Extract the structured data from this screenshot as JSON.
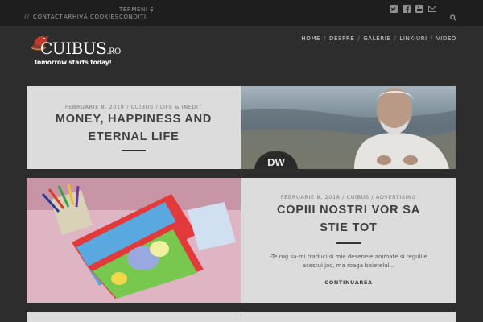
{
  "topbar": {
    "separator": "//",
    "links": [
      "Contact",
      "Arhivă",
      "Cookies",
      "Termeni și",
      "Condiții"
    ],
    "social_icons": [
      "twitter-icon",
      "facebook-icon",
      "youtube-icon",
      "email-icon"
    ],
    "search_icon": "search-icon"
  },
  "header": {
    "logo_text": "CUIBUS",
    "logo_suffix": ".RO",
    "tagline": "Tomorrow starts today!",
    "nav": [
      "Home",
      "Despre",
      "Galerie",
      "Link-uri",
      "Video"
    ]
  },
  "posts": [
    {
      "meta": "Februarie 8, 2018 / Cuibus / Life & Inedit",
      "title_line1": "MONEY, HAPPINESS AND",
      "title_line2": "ETERNAL LIFE"
    },
    {
      "image_badge": "DW"
    },
    {
      "image_alt": "Hippo and Friends puzzle books"
    },
    {
      "meta": "Februarie 8, 2018 / Cuibus / Advertising",
      "title_line1": "COPIII NOSTRI VOR SA",
      "title_line2": "STIE TOT",
      "excerpt": "-Te rog sa-mi traduci si mie desenele animate si regulile acestui joc, ma roaga baietelul...",
      "read_more": "Continuarea"
    }
  ],
  "colors": {
    "page_bg": "#2d2d2d",
    "topbar_bg": "#1e1e1e",
    "card_bg": "#dcdcdc"
  }
}
